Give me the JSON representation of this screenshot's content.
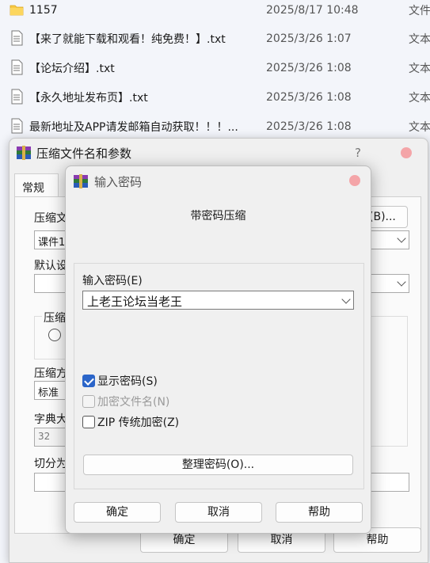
{
  "files": [
    {
      "name": "1157",
      "date": "2025/8/17 10:48",
      "type": "文件",
      "icon": "folder-icon"
    },
    {
      "name": "【来了就能下载和观看！纯免费！】.txt",
      "date": "2025/3/26 1:07",
      "type": "文本",
      "icon": "text-file-icon"
    },
    {
      "name": "【论坛介绍】.txt",
      "date": "2025/3/26 1:08",
      "type": "文本",
      "icon": "text-file-icon"
    },
    {
      "name": "【永久地址发布页】.txt",
      "date": "2025/3/26 1:08",
      "type": "文本",
      "icon": "text-file-icon"
    },
    {
      "name": "最新地址及APP请发邮箱自动获取！！！...",
      "date": "2025/3/26 1:08",
      "type": "文本",
      "icon": "text-file-icon"
    }
  ],
  "back_dialog": {
    "title": "压缩文件名和参数",
    "help": "?",
    "tab": "常规",
    "archive_label": "压缩文",
    "archive_value": "课件1",
    "browse": "(B)...",
    "default_label": "默认设",
    "group_label": "压缩",
    "method_label": "压缩方",
    "method_value": "标准",
    "dict_label": "字典大",
    "dict_value": "32",
    "split_label": "切分为",
    "ok": "确定",
    "cancel": "取消",
    "help_btn": "帮助"
  },
  "password_dialog": {
    "title": "输入密码",
    "heading": "带密码压缩",
    "password_label": "输入密码(E)",
    "password_value": "上老王论坛当老王",
    "show_password": "显示密码(S)",
    "show_password_checked": true,
    "encrypt_names": "加密文件名(N)",
    "encrypt_names_enabled": false,
    "zip_legacy": "ZIP 传统加密(Z)",
    "zip_legacy_checked": false,
    "organize": "整理密码(O)...",
    "ok": "确定",
    "cancel": "取消",
    "help": "帮助"
  }
}
